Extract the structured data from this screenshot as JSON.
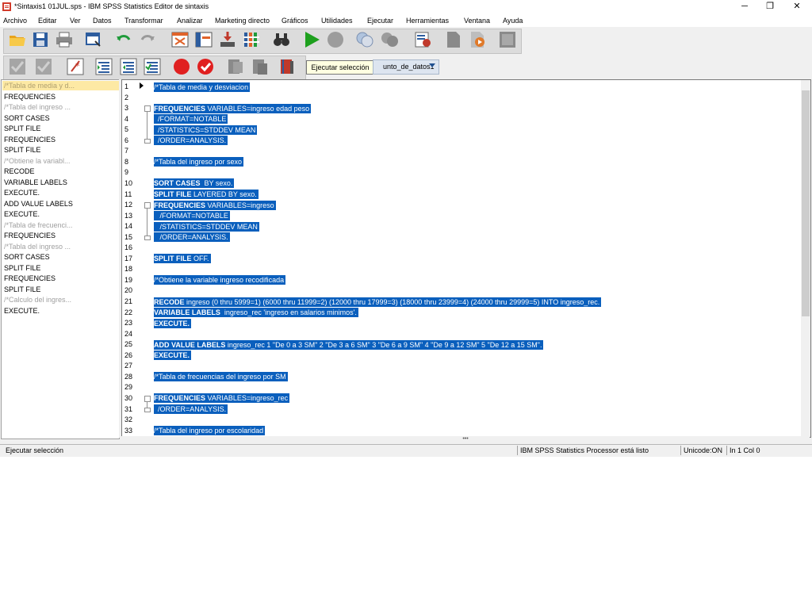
{
  "window": {
    "title": "*Sintaxis1 01JUL.sps - IBM SPSS Statistics Editor de sintaxis",
    "minimize": "─",
    "restore": "❐",
    "close": "✕"
  },
  "menu": [
    "Archivo",
    "Editar",
    "Ver",
    "Datos",
    "Transformar",
    "Analizar",
    "Marketing directo",
    "Gráficos",
    "Utilidades",
    "Ejecutar",
    "Herramientas",
    "Ventana",
    "Ayuda"
  ],
  "toolbar": {
    "icons": [
      "open-folder-icon",
      "save-icon",
      "print-icon",
      "recall-dialog-icon",
      "undo-icon",
      "redo-icon",
      "goto-case-icon",
      "goto-variable-icon",
      "variables-icon",
      "find-icon",
      "binoculars-icon",
      "run-icon",
      "stop-icon",
      "split-icon",
      "group-icon",
      "help-icon",
      "doc-icon",
      "doc-run-icon",
      "blank-icon"
    ]
  },
  "tooltip": "Ejecutar selección",
  "dataset": {
    "label": "unto_de_datos1"
  },
  "nav": [
    {
      "label": "/*Tabla de media y d...",
      "comment": true,
      "selected": true
    },
    {
      "label": "FREQUENCIES",
      "comment": false
    },
    {
      "label": "/*Tabla del ingreso ...",
      "comment": true
    },
    {
      "label": "SORT CASES",
      "comment": false
    },
    {
      "label": "SPLIT FILE",
      "comment": false
    },
    {
      "label": "FREQUENCIES",
      "comment": false
    },
    {
      "label": "SPLIT FILE",
      "comment": false
    },
    {
      "label": "/*Obtiene la variabl...",
      "comment": true
    },
    {
      "label": "RECODE",
      "comment": false
    },
    {
      "label": "VARIABLE LABELS",
      "comment": false
    },
    {
      "label": "EXECUTE.",
      "comment": false
    },
    {
      "label": "ADD VALUE LABELS",
      "comment": false
    },
    {
      "label": "EXECUTE.",
      "comment": false
    },
    {
      "label": "/*Tabla de frecuenci...",
      "comment": true
    },
    {
      "label": "FREQUENCIES",
      "comment": false
    },
    {
      "label": "/*Tabla del ingreso ...",
      "comment": true
    },
    {
      "label": "SORT CASES",
      "comment": false
    },
    {
      "label": "SPLIT FILE",
      "comment": false
    },
    {
      "label": "FREQUENCIES",
      "comment": false
    },
    {
      "label": "SPLIT FILE",
      "comment": false
    },
    {
      "label": "/*Calculo del ingres...",
      "comment": true
    },
    {
      "label": "EXECUTE.",
      "comment": false
    }
  ],
  "lines": [
    {
      "n": "1",
      "kw": "",
      "text": "/*Tabla de media y desviacion"
    },
    {
      "n": "2",
      "kw": "",
      "text": ""
    },
    {
      "n": "3",
      "kw": "FREQUENCIES",
      "text": " VARIABLES=ingreso edad peso"
    },
    {
      "n": "4",
      "kw": "",
      "text": "  /FORMAT=NOTABLE"
    },
    {
      "n": "5",
      "kw": "",
      "text": "  /STATISTICS=STDDEV MEAN"
    },
    {
      "n": "6",
      "kw": "",
      "text": "  /ORDER=ANALYSIS."
    },
    {
      "n": "7",
      "kw": "",
      "text": ""
    },
    {
      "n": "8",
      "kw": "",
      "text": "/*Tabla del ingreso por sexo"
    },
    {
      "n": "9",
      "kw": "",
      "text": ""
    },
    {
      "n": "10",
      "kw": "SORT CASES",
      "text": "  BY sexo."
    },
    {
      "n": "11",
      "kw": "SPLIT FILE",
      "text": " LAYERED BY sexo."
    },
    {
      "n": "12",
      "kw": "FREQUENCIES",
      "text": " VARIABLES=ingreso"
    },
    {
      "n": "13",
      "kw": "",
      "text": "   /FORMAT=NOTABLE"
    },
    {
      "n": "14",
      "kw": "",
      "text": "   /STATISTICS=STDDEV MEAN"
    },
    {
      "n": "15",
      "kw": "",
      "text": "   /ORDER=ANALYSIS."
    },
    {
      "n": "16",
      "kw": "",
      "text": ""
    },
    {
      "n": "17",
      "kw": "SPLIT FILE",
      "text": " OFF."
    },
    {
      "n": "18",
      "kw": "",
      "text": ""
    },
    {
      "n": "19",
      "kw": "",
      "text": "/*Obtiene la variable ingreso recodificada"
    },
    {
      "n": "20",
      "kw": "",
      "text": ""
    },
    {
      "n": "21",
      "kw": "RECODE",
      "text": " ingreso (0 thru 5999=1) (6000 thru 11999=2) (12000 thru 17999=3) (18000 thru 23999=4) (24000 thru 29999=5) INTO ingreso_rec."
    },
    {
      "n": "22",
      "kw": "VARIABLE LABELS",
      "text": "  ingreso_rec 'ingreso en salarios minimos'."
    },
    {
      "n": "23",
      "kw": "EXECUTE.",
      "text": ""
    },
    {
      "n": "24",
      "kw": "",
      "text": ""
    },
    {
      "n": "25",
      "kw": "ADD VALUE LABELS",
      "text": " ingreso_rec 1 \"De 0 a 3 SM\" 2 \"De 3 a 6 SM\" 3 \"De 6 a 9 SM\" 4 \"De 9 a 12 SM\" 5 \"De 12 a 15 SM\"."
    },
    {
      "n": "26",
      "kw": "EXECUTE.",
      "text": ""
    },
    {
      "n": "27",
      "kw": "",
      "text": ""
    },
    {
      "n": "28",
      "kw": "",
      "text": "/*Tabla de frecuencias del ingreso por SM"
    },
    {
      "n": "29",
      "kw": "",
      "text": ""
    },
    {
      "n": "30",
      "kw": "FREQUENCIES",
      "text": " VARIABLES=ingreso_rec"
    },
    {
      "n": "31",
      "kw": "",
      "text": "  /ORDER=ANALYSIS."
    },
    {
      "n": "32",
      "kw": "",
      "text": ""
    },
    {
      "n": "33",
      "kw": "",
      "text": "/*Tabla del ingreso por escolaridad"
    }
  ],
  "splitter": "•••",
  "status": {
    "left": "Ejecutar selección",
    "processor": "IBM SPSS Statistics Processor está listo",
    "unicode": "Unicode:ON",
    "position": "In 1 Col 0"
  },
  "colors": {
    "selection": "#0a5fbd",
    "nav_selected": "#fde9a4",
    "run_green": "#1ea01e",
    "stop_red": "#e02020"
  }
}
